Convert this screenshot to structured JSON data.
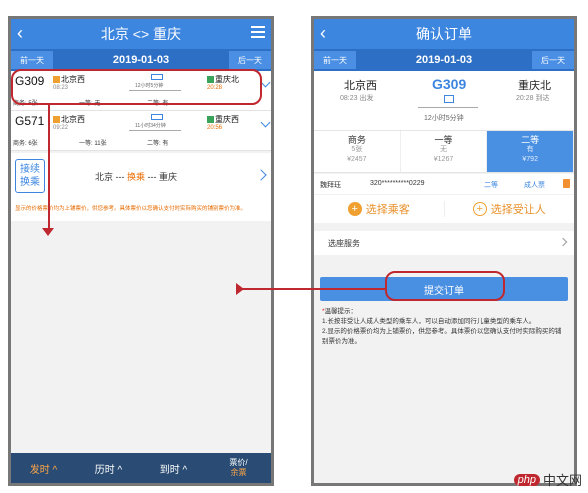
{
  "left": {
    "header": {
      "title": "北京 <> 重庆",
      "back_icon": "chevron-left-icon",
      "menu_icon": "menu-icon"
    },
    "datebar": {
      "prev": "前一天",
      "date": "2019-01-03",
      "next": "后一天"
    },
    "trains": [
      {
        "no": "G309",
        "seats_left": "商务: 5张",
        "from": "北京西",
        "from_time": "08:23",
        "duration": "12小时5分钟",
        "to": "重庆北",
        "to_time": "20:28",
        "class1": "一等: 无",
        "class2": "二等: 有"
      },
      {
        "no": "G571",
        "seats_left": "商务: 6张",
        "from": "北京西",
        "from_time": "09:22",
        "duration": "11小时34分钟",
        "to": "重庆西",
        "to_time": "20:56",
        "class1": "一等: 11张",
        "class2": "二等: 有"
      }
    ],
    "transfer": {
      "btn_line1": "接续",
      "btn_line2": "换乘",
      "route_from": "北京 ---",
      "route_mid": "换乘",
      "route_to": "--- 重庆"
    },
    "notice": "显示的价格票价均为上铺票价，供您参考。具体票价以您确认支付时实际购买的铺别票价为准。",
    "bottom": {
      "depart": "发时 ^",
      "duration": "历时 ^",
      "arrive": "到时 ^",
      "price_top": "票价",
      "price_bottom": "余票"
    }
  },
  "right": {
    "header": {
      "title": "确认订单",
      "back_icon": "chevron-left-icon"
    },
    "datebar": {
      "prev": "前一天",
      "date": "2019-01-03",
      "next": "后一天"
    },
    "trip": {
      "from": "北京西",
      "from_time": "08:23 出发",
      "no": "G309",
      "duration": "12小时5分钟",
      "to": "重庆北",
      "to_time": "20:28 到达"
    },
    "seats": [
      {
        "name": "商务",
        "count": "5张",
        "price": "¥2457"
      },
      {
        "name": "一等",
        "count": "无",
        "price": "¥1267"
      },
      {
        "name": "二等",
        "count": "有",
        "price": "¥792"
      }
    ],
    "passenger": {
      "name": "魏拜珏",
      "id": "320**********0229",
      "class": "二等",
      "type": "成人票"
    },
    "select_passenger": "选择乘客",
    "select_recipient": "选择受让人",
    "seat_service": "选座服务",
    "submit": "提交订单",
    "tips": {
      "title": "温馨提示：",
      "line1": "1.长按非受让人成人类型的乘车人，可以自动添加同行儿童类型的乘车人。",
      "line2": "2.显示的价格票价均为上铺票价，供您参考。具体票价以您确认支付时实际购买的铺别票价为准。"
    }
  },
  "watermark": {
    "logo": "php",
    "text": "中文网"
  },
  "colors": {
    "blue": "#3d86e0",
    "navy": "#2a4c74",
    "red_annotation": "#c0282f",
    "orange": "#e86b00"
  }
}
